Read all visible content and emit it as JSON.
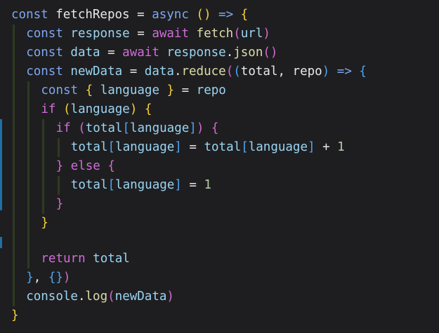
{
  "colors": {
    "background": "#1e1e20",
    "keyword": "#7fa6f0",
    "control": "#d06dd8",
    "variable": "#9bd4f2",
    "function": "#dcdcaa",
    "text": "#e8e8e8",
    "bracket_gold": "#f7d33b",
    "bracket_pink": "#d46ad0",
    "bracket_blue": "#4fa3f0",
    "number": "#b5cea8",
    "guide": "#2f3a22",
    "git_modified": "#1f6fa8"
  },
  "code": {
    "lines": [
      {
        "tokens": [
          {
            "t": "const ",
            "c": "kw"
          },
          {
            "t": "fetchRepos ",
            "c": "plain"
          },
          {
            "t": "= ",
            "c": "plain"
          },
          {
            "t": "async ",
            "c": "kw"
          },
          {
            "t": "() ",
            "c": "br-gold"
          },
          {
            "t": "=> ",
            "c": "kw"
          },
          {
            "t": "{",
            "c": "br-gold"
          }
        ]
      },
      {
        "tokens": [
          {
            "t": "const ",
            "c": "kw"
          },
          {
            "t": "response ",
            "c": "var"
          },
          {
            "t": "= ",
            "c": "plain"
          },
          {
            "t": "await ",
            "c": "ctl"
          },
          {
            "t": "fetch",
            "c": "prop"
          },
          {
            "t": "(",
            "c": "br-pink"
          },
          {
            "t": "url",
            "c": "var"
          },
          {
            "t": ")",
            "c": "br-pink"
          }
        ]
      },
      {
        "tokens": [
          {
            "t": "const ",
            "c": "kw"
          },
          {
            "t": "data ",
            "c": "var"
          },
          {
            "t": "= ",
            "c": "plain"
          },
          {
            "t": "await ",
            "c": "ctl"
          },
          {
            "t": "response",
            "c": "var"
          },
          {
            "t": ".",
            "c": "plain"
          },
          {
            "t": "json",
            "c": "prop"
          },
          {
            "t": "()",
            "c": "br-pink"
          }
        ]
      },
      {
        "tokens": [
          {
            "t": "const ",
            "c": "kw"
          },
          {
            "t": "newData ",
            "c": "var"
          },
          {
            "t": "= ",
            "c": "plain"
          },
          {
            "t": "data",
            "c": "var"
          },
          {
            "t": ".",
            "c": "plain"
          },
          {
            "t": "reduce",
            "c": "prop"
          },
          {
            "t": "(",
            "c": "br-pink"
          },
          {
            "t": "(",
            "c": "br-blue"
          },
          {
            "t": "total, repo",
            "c": "plain"
          },
          {
            "t": ") ",
            "c": "br-blue"
          },
          {
            "t": "=> ",
            "c": "kw"
          },
          {
            "t": "{",
            "c": "br-blue"
          }
        ]
      },
      {
        "tokens": [
          {
            "t": "const ",
            "c": "kw"
          },
          {
            "t": "{ ",
            "c": "br-gold"
          },
          {
            "t": "language ",
            "c": "var"
          },
          {
            "t": "} ",
            "c": "br-gold"
          },
          {
            "t": "= ",
            "c": "plain"
          },
          {
            "t": "repo",
            "c": "var"
          }
        ]
      },
      {
        "tokens": [
          {
            "t": "if ",
            "c": "ctl"
          },
          {
            "t": "(",
            "c": "br-gold"
          },
          {
            "t": "language",
            "c": "var"
          },
          {
            "t": ") ",
            "c": "br-gold"
          },
          {
            "t": "{",
            "c": "br-gold"
          }
        ]
      },
      {
        "tokens": [
          {
            "t": "if ",
            "c": "ctl"
          },
          {
            "t": "(",
            "c": "br-pink"
          },
          {
            "t": "total",
            "c": "var"
          },
          {
            "t": "[",
            "c": "br-blue"
          },
          {
            "t": "language",
            "c": "var"
          },
          {
            "t": "]",
            "c": "br-blue"
          },
          {
            "t": ") ",
            "c": "br-pink"
          },
          {
            "t": "{",
            "c": "br-pink"
          }
        ]
      },
      {
        "tokens": [
          {
            "t": "total",
            "c": "var"
          },
          {
            "t": "[",
            "c": "br-blue"
          },
          {
            "t": "language",
            "c": "var"
          },
          {
            "t": "] ",
            "c": "br-blue"
          },
          {
            "t": "= ",
            "c": "plain"
          },
          {
            "t": "total",
            "c": "var"
          },
          {
            "t": "[",
            "c": "br-blue"
          },
          {
            "t": "language",
            "c": "var"
          },
          {
            "t": "] ",
            "c": "br-blue"
          },
          {
            "t": "+ ",
            "c": "plain"
          },
          {
            "t": "1",
            "c": "num"
          }
        ]
      },
      {
        "tokens": [
          {
            "t": "} ",
            "c": "br-pink"
          },
          {
            "t": "else ",
            "c": "ctl"
          },
          {
            "t": "{",
            "c": "br-pink"
          }
        ]
      },
      {
        "tokens": [
          {
            "t": "total",
            "c": "var"
          },
          {
            "t": "[",
            "c": "br-blue"
          },
          {
            "t": "language",
            "c": "var"
          },
          {
            "t": "] ",
            "c": "br-blue"
          },
          {
            "t": "= ",
            "c": "plain"
          },
          {
            "t": "1",
            "c": "num"
          }
        ]
      },
      {
        "tokens": [
          {
            "t": "}",
            "c": "br-pink"
          }
        ]
      },
      {
        "tokens": [
          {
            "t": "}",
            "c": "br-gold"
          }
        ]
      },
      {
        "tokens": []
      },
      {
        "tokens": [
          {
            "t": "return ",
            "c": "ctl"
          },
          {
            "t": "total",
            "c": "var"
          }
        ]
      },
      {
        "tokens": [
          {
            "t": "}",
            "c": "br-blue"
          },
          {
            "t": ", ",
            "c": "plain"
          },
          {
            "t": "{}",
            "c": "br-blue"
          },
          {
            "t": ")",
            "c": "br-pink"
          }
        ]
      },
      {
        "tokens": [
          {
            "t": "console",
            "c": "var"
          },
          {
            "t": ".",
            "c": "plain"
          },
          {
            "t": "log",
            "c": "prop"
          },
          {
            "t": "(",
            "c": "br-pink"
          },
          {
            "t": "newData",
            "c": "var"
          },
          {
            "t": ")",
            "c": "br-pink"
          }
        ]
      },
      {
        "tokens": [
          {
            "t": "}",
            "c": "br-gold"
          }
        ]
      }
    ]
  }
}
